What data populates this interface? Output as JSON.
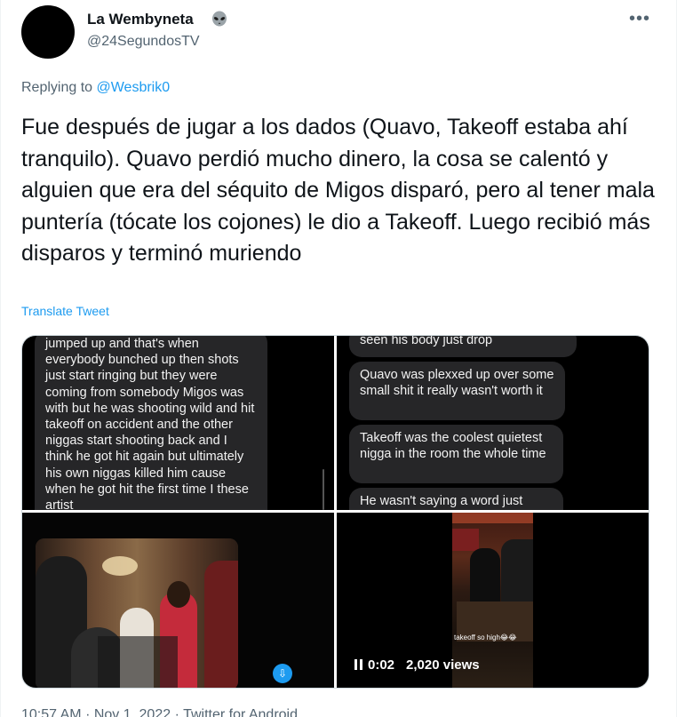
{
  "author": {
    "name": "La Wembyneta",
    "name_emoji": "👽",
    "handle": "@24SegundosTV"
  },
  "reply": {
    "prefix": "Replying to",
    "to": "@Wesbrik0"
  },
  "tweet": {
    "text": "Fue después de jugar a los dados (Quavo, Takeoff estaba ahí tranquilo). Quavo perdió mucho dinero, la cosa se calentó y alguien que era del séquito de Migos disparó, pero al tener mala puntería (tócate los cojones) le dio a Takeoff. Luego recibió más disparos y terminó muriendo",
    "translate_label": "Translate Tweet"
  },
  "media": {
    "left_chat_text": "jumped up and that's when everybody bunched up then shots just start ringing but they were coming from somebody Migos was with but he was shooting wild and hit takeoff on accident and the other niggas start shooting back and I think he got hit again but ultimately his own niggas killed him cause when he got hit the first time I these artist",
    "right_chat": [
      "seen his body just drop",
      "Quavo was plexxed up over some small shit it really wasn't worth it",
      "Takeoff was the coolest quietest nigga in the room the whole time",
      "He wasn't saying a word just chillin in the cut he didn't"
    ],
    "video_caption": "takeoff so high😂😂",
    "video_time": "0:02",
    "video_views": "2,020 views"
  },
  "footer": {
    "time": "10:57 AM",
    "date": "Nov 1, 2022",
    "source": "Twitter for Android",
    "separator": "·"
  },
  "colors": {
    "text": "#0f1419",
    "secondary": "#536471",
    "link": "#1d9bf0",
    "bubble": "#262628"
  }
}
